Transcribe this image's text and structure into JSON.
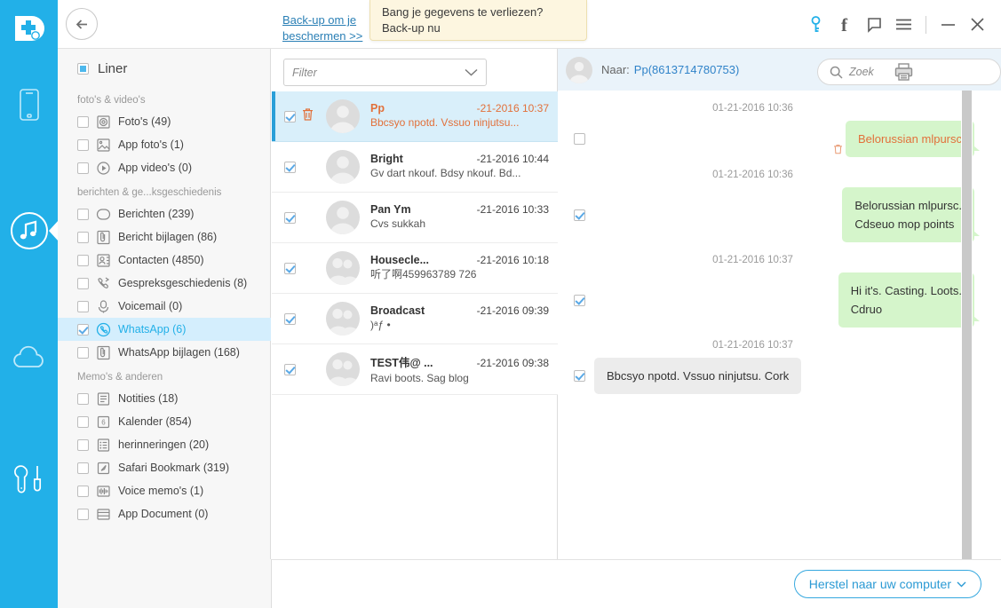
{
  "app": {
    "logo_icon": "app-shield-plus-logo",
    "rail_items": [
      {
        "icon": "phone-icon",
        "name": "device",
        "active": false
      },
      {
        "icon": "music-note-icon",
        "name": "media",
        "active": true
      },
      {
        "icon": "cloud-icon",
        "name": "cloud",
        "active": false
      },
      {
        "icon": "tools-icon",
        "name": "toolkit",
        "active": false
      }
    ]
  },
  "header": {
    "back_icon": "back-arrow-icon",
    "backup_link": "Back-up om je beschermen >>",
    "tooltip": "Bang je gegevens te verliezen? Back-up nu",
    "icons": [
      {
        "name": "key-icon",
        "glyph": "key"
      },
      {
        "name": "facebook-icon",
        "glyph": "f"
      },
      {
        "name": "feedback-icon",
        "glyph": "bubble"
      },
      {
        "name": "menu-icon",
        "glyph": "hamburger"
      },
      {
        "name": "minimize-icon",
        "glyph": "minus"
      },
      {
        "name": "close-icon",
        "glyph": "x"
      }
    ]
  },
  "sidebar": {
    "title": "Liner",
    "groups": [
      {
        "label": "foto's & video's",
        "items": [
          {
            "label": "Foto's (49)",
            "icon": "photos-icon",
            "checked": false,
            "selected": false
          },
          {
            "label": "App foto's (1)",
            "icon": "app-photos-icon",
            "checked": false,
            "selected": false
          },
          {
            "label": "App video's (0)",
            "icon": "app-videos-icon",
            "checked": false,
            "selected": false
          }
        ]
      },
      {
        "label": "berichten & ge...ksgeschiedenis",
        "items": [
          {
            "label": "Berichten (239)",
            "icon": "messages-icon",
            "checked": false,
            "selected": false
          },
          {
            "label": "Bericht bijlagen (86)",
            "icon": "attachment-icon",
            "checked": false,
            "selected": false
          },
          {
            "label": "Contacten (4850)",
            "icon": "contacts-icon",
            "checked": false,
            "selected": false
          },
          {
            "label": "Gespreksgeschiedenis (8)",
            "icon": "call-history-icon",
            "checked": false,
            "selected": false
          },
          {
            "label": "Voicemail (0)",
            "icon": "voicemail-icon",
            "checked": false,
            "selected": false
          },
          {
            "label": "WhatsApp (6)",
            "icon": "whatsapp-icon",
            "checked": true,
            "selected": true
          },
          {
            "label": "WhatsApp bijlagen (168)",
            "icon": "attachment-icon",
            "checked": false,
            "selected": false
          }
        ]
      },
      {
        "label": "Memo's & anderen",
        "items": [
          {
            "label": "Notities (18)",
            "icon": "notes-icon",
            "checked": false,
            "selected": false
          },
          {
            "label": "Kalender (854)",
            "icon": "calendar-icon",
            "checked": false,
            "selected": false
          },
          {
            "label": "herinneringen (20)",
            "icon": "reminders-icon",
            "checked": false,
            "selected": false
          },
          {
            "label": "Safari Bookmark (319)",
            "icon": "safari-bookmark-icon",
            "checked": false,
            "selected": false
          },
          {
            "label": "Voice memo's (1)",
            "icon": "voice-memo-icon",
            "checked": false,
            "selected": false
          },
          {
            "label": "App Document (0)",
            "icon": "app-document-icon",
            "checked": false,
            "selected": false
          }
        ]
      }
    ]
  },
  "list": {
    "filter_placeholder": "Filter",
    "rows": [
      {
        "name": "Pp",
        "date": "-21-2016 10:37",
        "preview": "Bbcsyo npotd. Vssuo ninjutsu...",
        "checked": true,
        "selected": true
      },
      {
        "name": "Bright",
        "date": "-21-2016 10:44",
        "preview": "Gv dart nkouf. Bdsy nkouf. Bd...",
        "checked": true,
        "selected": false
      },
      {
        "name": "Pan Ym",
        "date": "-21-2016 10:33",
        "preview": "Cvs sukkah",
        "checked": true,
        "selected": false
      },
      {
        "name": "Housecle...",
        "date": "-21-2016 10:18",
        "preview": "听了啊459963789 726",
        "checked": true,
        "selected": false
      },
      {
        "name": "Broadcast",
        "date": "-21-2016 09:39",
        "preview": ")ᵃƒ    •",
        "checked": true,
        "selected": false
      },
      {
        "name": "TEST伟@ ...",
        "date": "-21-2016 09:38",
        "preview": "Ravi boots. Sag blog",
        "checked": true,
        "selected": false
      }
    ]
  },
  "chat": {
    "to_label": "Naar:",
    "to_value": "Pp(8613714780753)",
    "messages": [
      {
        "date": "01-21-2016 10:36",
        "side": "out",
        "style": "green",
        "orange": true,
        "deleted": true,
        "lines": [
          "Belorussian mlpursc"
        ],
        "checked": false
      },
      {
        "date": "01-21-2016 10:36",
        "side": "out",
        "style": "green",
        "orange": false,
        "deleted": false,
        "lines": [
          "Belorussian mlpursc.",
          "Cdseuo mop points"
        ],
        "checked": true
      },
      {
        "date": "01-21-2016 10:37",
        "side": "out",
        "style": "green",
        "orange": false,
        "deleted": false,
        "lines": [
          "Hi it's. Casting. Loots.",
          "Cdruo"
        ],
        "checked": true
      },
      {
        "date": "01-21-2016 10:37",
        "side": "in",
        "style": "grey",
        "orange": false,
        "deleted": false,
        "lines": [
          "Bbcsyo npotd. Vssuo ninjutsu.  Cork"
        ],
        "checked": true
      }
    ]
  },
  "search": {
    "placeholder": "Zoek",
    "search_icon": "search-icon",
    "print_icon": "printer-icon"
  },
  "footer": {
    "restore_label": "Herstel naar uw computer",
    "chevron_icon": "chevron-down-icon"
  },
  "colors": {
    "brand_blue": "#22b0e8",
    "accent_orange": "#e2703a",
    "bubble_green": "#d5f5cb",
    "bubble_grey": "#ececec",
    "selected_row": "#d9effa"
  }
}
